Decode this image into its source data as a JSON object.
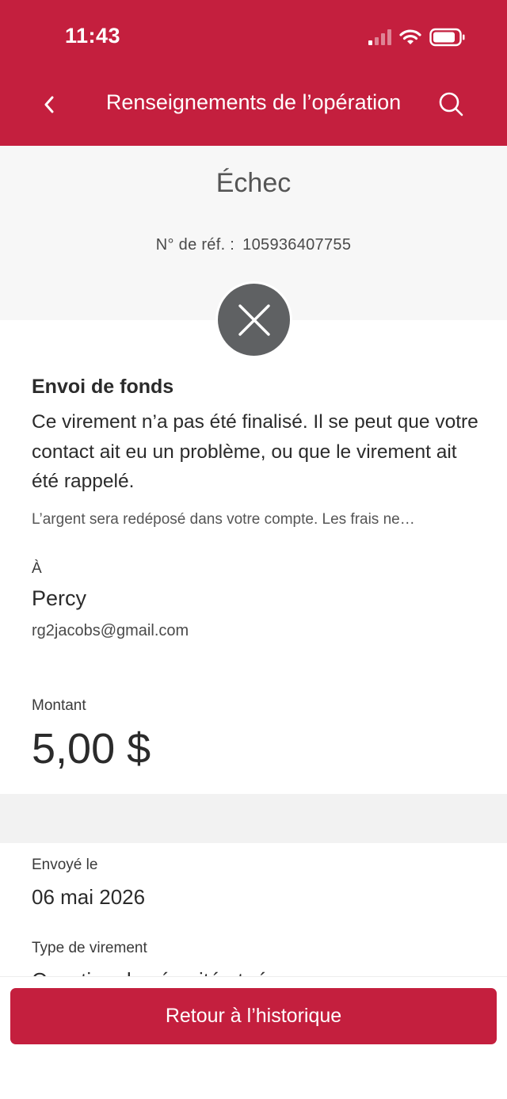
{
  "status_bar": {
    "time": "11:43"
  },
  "nav": {
    "title": "Renseignements de l’opération",
    "back_icon": "chevron-left-icon",
    "search_icon": "search-icon"
  },
  "header": {
    "status": "Échec",
    "ref_label": "N° de réf. :",
    "ref_value": "105936407755",
    "status_icon": "close-icon"
  },
  "details": {
    "heading": "Envoi de fonds",
    "message": "Ce virement n’a pas été finalisé. Il se peut que votre contact ait eu un problème, ou que le virement ait été rappelé.",
    "note": "L’argent sera redéposé dans votre compte. Les frais ne…",
    "to_label": "À",
    "recipient_name": "Percy",
    "recipient_email": "rg2jacobs@gmail.com",
    "amount_label": "Montant",
    "amount": "5,00 $"
  },
  "extra": {
    "sent_label": "Envoyé le",
    "sent_date": "06 mai 2026",
    "type_label": "Type de virement",
    "type_value": "Question de sécurité et réponse"
  },
  "footer": {
    "button_label": "Retour à l’historique"
  },
  "colors": {
    "brand": "#c41f3e",
    "status_circle": "#5f6163"
  }
}
